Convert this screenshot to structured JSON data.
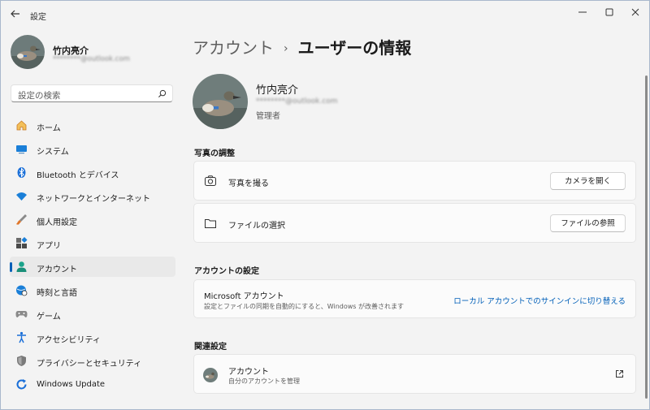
{
  "window": {
    "title": "設定"
  },
  "profile": {
    "name": "竹内亮介",
    "email": "********@outlook.com"
  },
  "search": {
    "placeholder": "設定の検索"
  },
  "nav": {
    "items": [
      {
        "label": "ホーム",
        "icon": "home-icon"
      },
      {
        "label": "システム",
        "icon": "system-icon"
      },
      {
        "label": "Bluetooth とデバイス",
        "icon": "bluetooth-icon"
      },
      {
        "label": "ネットワークとインターネット",
        "icon": "wifi-icon"
      },
      {
        "label": "個人用設定",
        "icon": "brush-icon"
      },
      {
        "label": "アプリ",
        "icon": "apps-icon"
      },
      {
        "label": "アカウント",
        "icon": "person-icon"
      },
      {
        "label": "時刻と言語",
        "icon": "globe-clock-icon"
      },
      {
        "label": "ゲーム",
        "icon": "gamepad-icon"
      },
      {
        "label": "アクセシビリティ",
        "icon": "accessibility-icon"
      },
      {
        "label": "プライバシーとセキュリティ",
        "icon": "shield-icon"
      },
      {
        "label": "Windows Update",
        "icon": "update-icon"
      }
    ],
    "active_index": 6
  },
  "breadcrumb": {
    "parent": "アカウント",
    "separator": "›",
    "current": "ユーザーの情報"
  },
  "user": {
    "name": "竹内亮介",
    "email": "********@outlook.com",
    "role": "管理者"
  },
  "photo_section": {
    "heading": "写真の調整",
    "take_photo": {
      "label": "写真を撮る",
      "button": "カメラを開く",
      "icon": "camera-icon"
    },
    "choose_file": {
      "label": "ファイルの選択",
      "button": "ファイルの参照",
      "icon": "folder-icon"
    }
  },
  "account_section": {
    "heading": "アカウントの設定",
    "title": "Microsoft アカウント",
    "subtitle": "設定とファイルの同期を自動的にすると、Windows が改善されます",
    "link": "ローカル アカウントでのサインインに切り替える"
  },
  "related_section": {
    "heading": "関連設定",
    "title": "アカウント",
    "subtitle": "自分のアカウントを管理",
    "icon": "external-link-icon"
  },
  "colors": {
    "accent": "#005fb8",
    "background": "#f3f3f3",
    "card": "#fbfbfb"
  }
}
